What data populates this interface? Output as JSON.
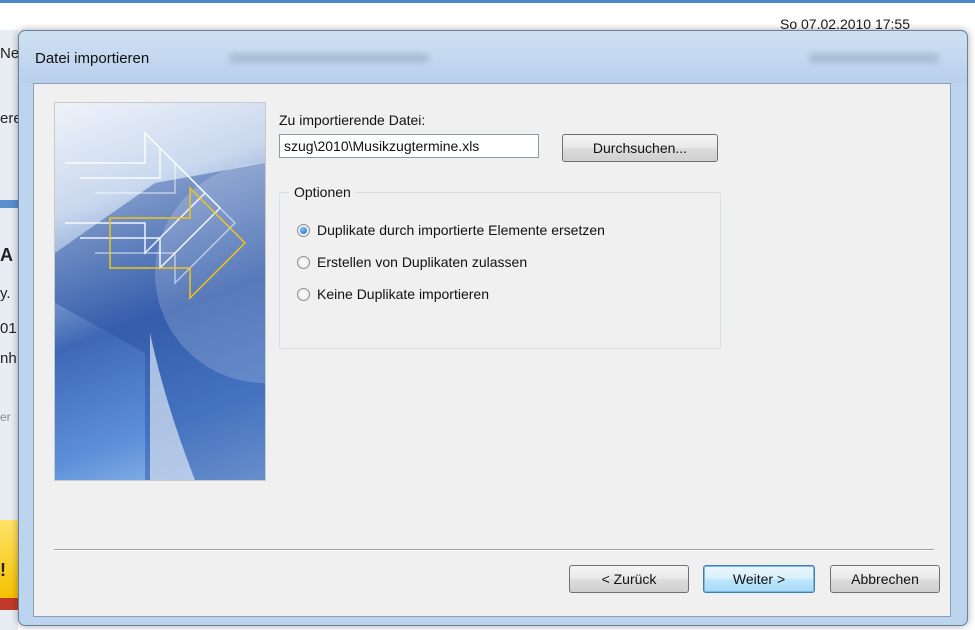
{
  "background": {
    "clock": "So 07.02.2010 17:55",
    "fragments": [
      "Ne",
      "ere",
      "A",
      "y.",
      "01",
      "nh",
      "er",
      "!"
    ]
  },
  "dialog": {
    "title": "Datei importieren",
    "file_label": "Zu importierende Datei:",
    "file_value": "szug\\2010\\Musikzugtermine.xls",
    "browse_label": "Durchsuchen...",
    "options": {
      "legend": "Optionen",
      "items": [
        {
          "label": "Duplikate durch importierte Elemente ersetzen",
          "checked": true
        },
        {
          "label": "Erstellen von Duplikaten zulassen",
          "checked": false
        },
        {
          "label": "Keine Duplikate importieren",
          "checked": false
        }
      ]
    },
    "buttons": {
      "back": "< Zurück",
      "next": "Weiter >",
      "cancel": "Abbrechen"
    }
  }
}
